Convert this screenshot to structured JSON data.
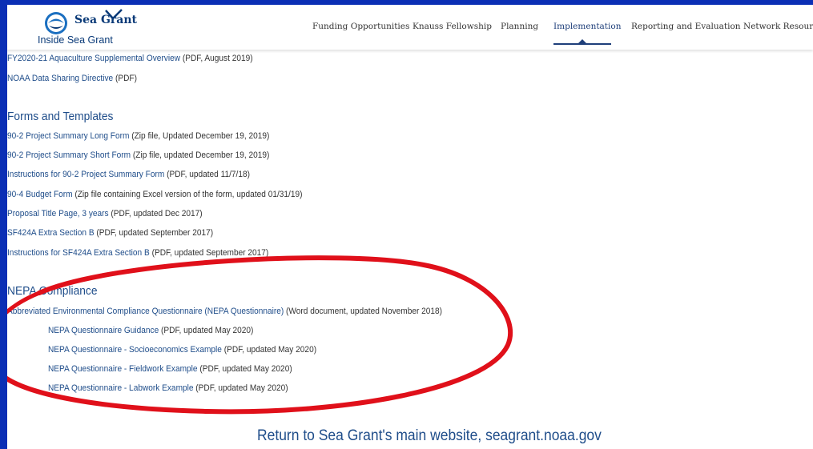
{
  "header": {
    "wordmark": "Sea Grant",
    "subtitle": "Inside Sea Grant",
    "nav": [
      {
        "label": "Funding Opportunities"
      },
      {
        "label": "Knauss Fellowship"
      },
      {
        "label": "Planning"
      },
      {
        "label": "Implementation",
        "active": true
      },
      {
        "label": "Reporting and Evaluation"
      },
      {
        "label": "Network Resources"
      }
    ]
  },
  "top_links": [
    {
      "link": "FY2020-21 Aquaculture Supplemental Overview",
      "note": " (PDF, August 2019)"
    },
    {
      "link": "NOAA Data Sharing Directive",
      "note": " (PDF)"
    }
  ],
  "forms_section": {
    "title": "Forms and Templates",
    "items": [
      {
        "link": "90-2 Project Summary Long Form",
        "note": " (Zip file, Updated December 19, 2019)"
      },
      {
        "link": "90-2 Project Summary Short Form",
        "note": " (Zip file, updated December 19, 2019)"
      },
      {
        "link": "Instructions for 90-2 Project Summary Form",
        "note": " (PDF, updated 11/7/18)"
      },
      {
        "link": "90-4 Budget Form",
        "note": " (Zip file containing Excel version of the form, updated 01/31/19)"
      },
      {
        "link": "Proposal Title Page, 3 years",
        "note": " (PDF, updated Dec 2017)"
      },
      {
        "link": "SF424A Extra Section B",
        "note": " (PDF, updated September 2017)"
      },
      {
        "link": "Instructions for SF424A Extra Section B",
        "note": " (PDF, updated September 2017)"
      }
    ]
  },
  "nepa_section": {
    "title": "NEPA Compliance",
    "main": {
      "link": "Abbreviated Environmental Compliance Questionnaire (NEPA Questionnaire)",
      "note": " (Word document, updated November 2018)"
    },
    "sub_items": [
      {
        "link": "NEPA Questionnaire Guidance",
        "note": " (PDF, updated May 2020)"
      },
      {
        "link": "NEPA Questionnaire - Socioeconomics Example",
        "note": " (PDF, updated May 2020)"
      },
      {
        "link": "NEPA Questionnaire - Fieldwork Example",
        "note": " (PDF, updated May 2020)"
      },
      {
        "link": "NEPA Questionnaire - Labwork Example",
        "note": " (PDF, updated May 2020)"
      }
    ]
  },
  "footer": {
    "return_link": "Return to Sea Grant's main website, seagrant.noaa.gov"
  },
  "colors": {
    "border": "#0b2fb5",
    "link": "#1f4d8a",
    "annotation": "#e0101a"
  }
}
